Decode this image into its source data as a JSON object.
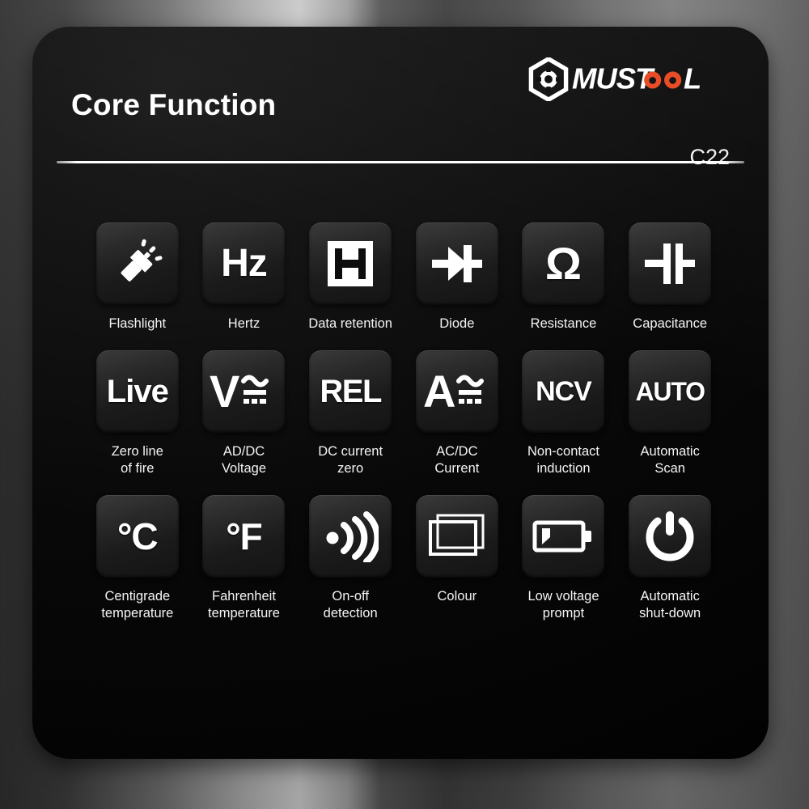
{
  "header": {
    "title": "Core Function",
    "model": "C22",
    "brand_name": "MUSTOOL",
    "brand_accent_color": "#e8461e",
    "brand_text_color": "#ffffff"
  },
  "features": [
    {
      "icon": "flashlight-icon",
      "glyph": "",
      "label": "Flashlight"
    },
    {
      "icon": "hertz-icon",
      "glyph": "Hz",
      "label": "Hertz"
    },
    {
      "icon": "data-retention-icon",
      "glyph": "H",
      "label": "Data retention"
    },
    {
      "icon": "diode-icon",
      "glyph": "",
      "label": "Diode"
    },
    {
      "icon": "resistance-ohm-icon",
      "glyph": "Ω",
      "label": "Resistance"
    },
    {
      "icon": "capacitance-icon",
      "glyph": "",
      "label": "Capacitance"
    },
    {
      "icon": "live-wire-icon",
      "glyph": "Live",
      "label": "Zero line\nof fire"
    },
    {
      "icon": "voltage-acdc-icon",
      "glyph": "V",
      "label": "AD/DC\nVoltage"
    },
    {
      "icon": "relative-zero-icon",
      "glyph": "REL",
      "label": "DC current\nzero"
    },
    {
      "icon": "current-acdc-icon",
      "glyph": "A",
      "label": "AC/DC\nCurrent"
    },
    {
      "icon": "ncv-icon",
      "glyph": "NCV",
      "label": "Non-contact\ninduction"
    },
    {
      "icon": "auto-range-icon",
      "glyph": "AUTO",
      "label": "Automatic\nScan"
    },
    {
      "icon": "celsius-icon",
      "glyph": "°C",
      "label": "Centigrade\ntemperature"
    },
    {
      "icon": "fahrenheit-icon",
      "glyph": "°F",
      "label": "Fahrenheit\ntemperature"
    },
    {
      "icon": "continuity-icon",
      "glyph": "",
      "label": "On-off\ndetection"
    },
    {
      "icon": "colour-screen-icon",
      "glyph": "",
      "label": "Colour"
    },
    {
      "icon": "low-battery-icon",
      "glyph": "",
      "label": "Low voltage\nprompt"
    },
    {
      "icon": "power-off-icon",
      "glyph": "",
      "label": "Automatic\nshut-down"
    }
  ]
}
